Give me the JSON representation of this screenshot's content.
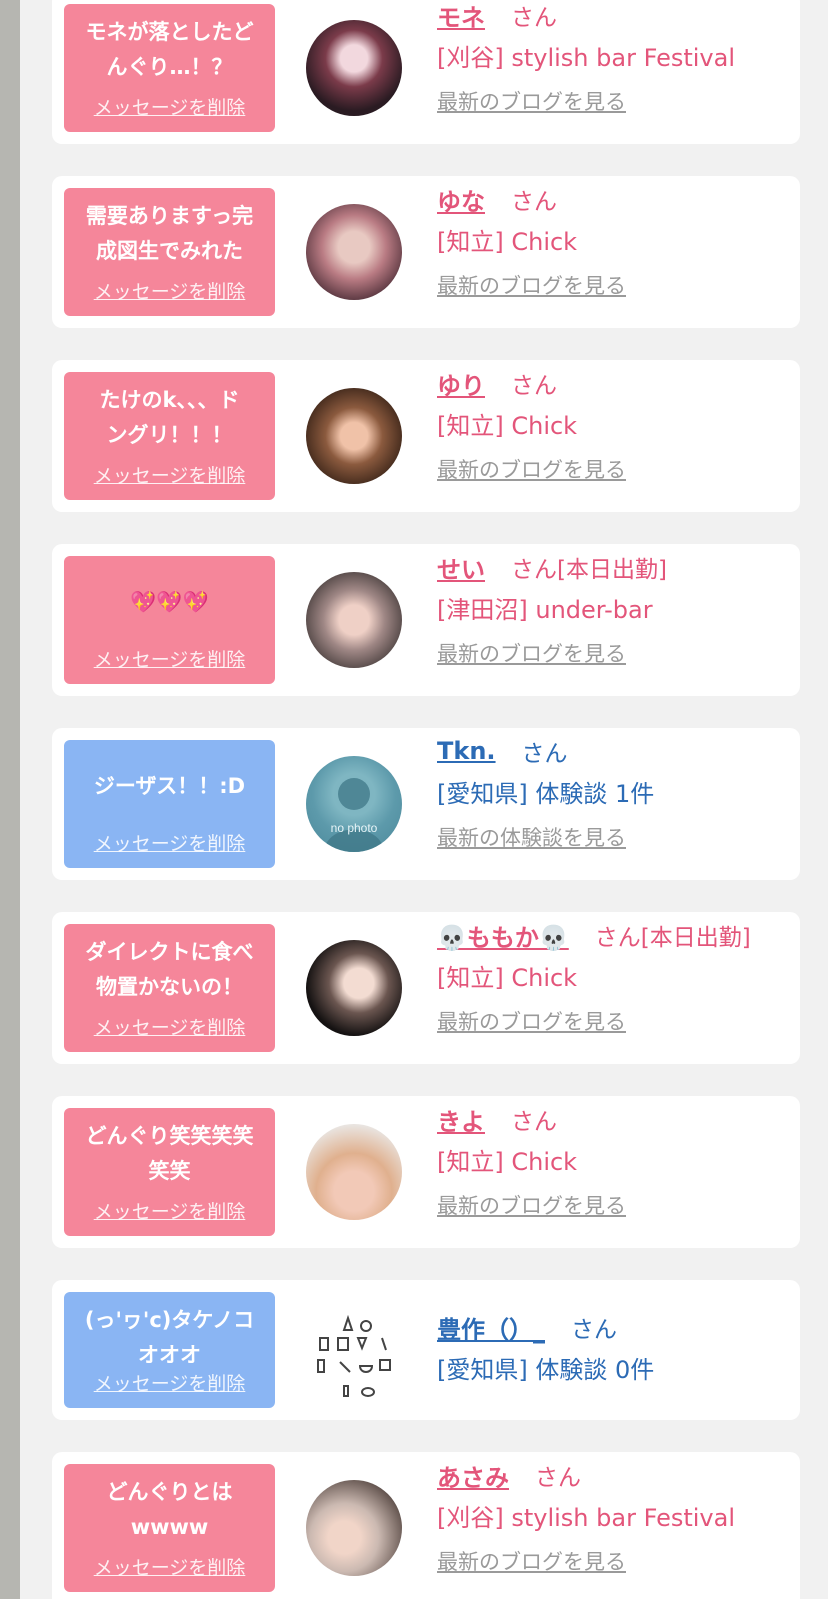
{
  "delete_label": "メッセージを削除",
  "colors": {
    "pink": "#f5869a",
    "blue": "#8ab5f3",
    "name_pink": "#e3557a",
    "name_blue": "#2c6bb5"
  },
  "items": [
    {
      "color": "pink",
      "message": "モネが落としたど\nんぐり…！？",
      "name": "モネ",
      "suffix": "さん",
      "store": "[刈谷] stylish bar Festival",
      "link": "最新のブログを見る",
      "avatar": "avatar-icon"
    },
    {
      "color": "pink",
      "message": "需要ありますっ完\n成図生でみれた",
      "name": "ゆな",
      "suffix": "さん",
      "store": "[知立] Chick",
      "link": "最新のブログを見る",
      "avatar": "avatar-icon"
    },
    {
      "color": "pink",
      "message": "たけのk、、、ド\nングリ！！！",
      "name": "ゆり",
      "suffix": "さん",
      "store": "[知立] Chick",
      "link": "最新のブログを見る",
      "avatar": "avatar-icon"
    },
    {
      "color": "pink",
      "message": "💖💖💖",
      "name": "せい",
      "suffix": "さん[本日出勤]",
      "store": "[津田沼] under-bar",
      "link": "最新のブログを見る",
      "avatar": "avatar-icon"
    },
    {
      "color": "blue",
      "message": "ジーザス！！:D",
      "name": "Tkn.",
      "suffix": "さん",
      "store": "[愛知県] 体験談 1件",
      "link": "最新の体験談を見る",
      "avatar": "no-photo-icon",
      "avatar_text": "no photo"
    },
    {
      "color": "pink",
      "message": "ダイレクトに食べ\n物置かないの！",
      "name": "💀ももか💀",
      "suffix": "さん[本日出勤]",
      "store": "[知立] Chick",
      "link": "最新のブログを見る",
      "avatar": "avatar-icon"
    },
    {
      "color": "pink",
      "message": "どんぐり笑笑笑笑\n笑笑",
      "name": "きよ",
      "suffix": "さん",
      "store": "[知立] Chick",
      "link": "最新のブログを見る",
      "avatar": "avatar-icon"
    },
    {
      "color": "blue",
      "message": "(っ'ヮ'c)タケノコ\nオオオ",
      "name": "豊作（）_",
      "suffix": "さん",
      "store": "[愛知県] 体験談 0件",
      "link": "",
      "avatar": "lab-tools-icon"
    },
    {
      "color": "pink",
      "message": "どんぐりとは\nwwww",
      "name": "あさみ",
      "suffix": "さん",
      "store": "[刈谷] stylish bar Festival",
      "link": "最新のブログを見る",
      "avatar": "avatar-icon"
    }
  ]
}
